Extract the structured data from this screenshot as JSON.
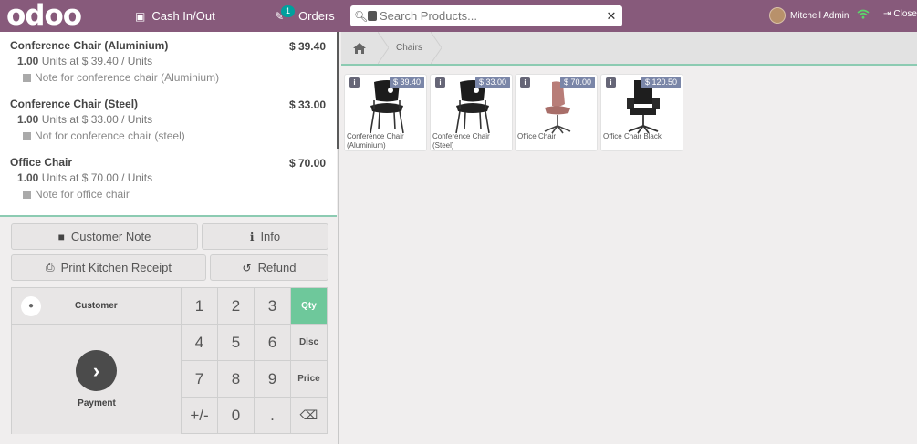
{
  "topbar": {
    "logo": "odoo",
    "cash_label": "Cash In/Out",
    "orders_label": "Orders",
    "orders_badge": "1",
    "search_placeholder": "Search Products...",
    "user_name": "Mitchell Admin",
    "close_label": "Close"
  },
  "order": {
    "lines": [
      {
        "name": "Conference Chair (Aluminium)",
        "price": "$ 39.40",
        "qty": "1.00",
        "unit_info": "Units at $ 39.40 / Units",
        "note": "Note for conference chair (Aluminium)"
      },
      {
        "name": "Conference Chair (Steel)",
        "price": "$ 33.00",
        "qty": "1.00",
        "unit_info": "Units at $ 33.00 / Units",
        "note": "Not for conference chair (steel)"
      },
      {
        "name": "Office Chair",
        "price": "$ 70.00",
        "qty": "1.00",
        "unit_info": "Units at $ 70.00 / Units",
        "note": "Note for office chair"
      }
    ]
  },
  "controls": {
    "customer_note": "Customer Note",
    "info": "Info",
    "print_kitchen": "Print Kitchen Receipt",
    "refund": "Refund"
  },
  "numpad": {
    "customer": "Customer",
    "payment": "Payment",
    "keys": [
      "1",
      "2",
      "3",
      "4",
      "5",
      "6",
      "7",
      "8",
      "9",
      "+/-",
      "0",
      "."
    ],
    "modes": {
      "qty": "Qty",
      "disc": "Disc",
      "price": "Price"
    },
    "backspace": "⌫"
  },
  "breadcrumb": {
    "category": "Chairs"
  },
  "products": [
    {
      "name": "Conference Chair (Aluminium)",
      "price": "$ 39.40"
    },
    {
      "name": "Conference Chair (Steel)",
      "price": "$ 33.00"
    },
    {
      "name": "Office Chair",
      "price": "$ 70.00"
    },
    {
      "name": "Office Chair Black",
      "price": "$ 120.50"
    }
  ],
  "colors": {
    "brand": "#875a7b",
    "accent": "#6ec89b",
    "price_tag": "#7a86a8"
  }
}
